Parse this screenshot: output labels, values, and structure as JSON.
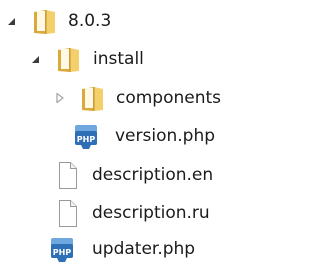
{
  "tree": {
    "root": {
      "label": "8.0.3",
      "expanded": true,
      "icon": "folder-icon"
    },
    "install": {
      "label": "install",
      "expanded": true,
      "icon": "folder-icon"
    },
    "components": {
      "label": "components",
      "expanded": false,
      "icon": "folder-icon"
    },
    "version_php": {
      "label": "version.php",
      "icon": "php-file-icon",
      "icon_text": "PHP"
    },
    "description_en": {
      "label": "description.en",
      "icon": "blank-file-icon"
    },
    "description_ru": {
      "label": "description.ru",
      "icon": "blank-file-icon"
    },
    "updater_php": {
      "label": "updater.php",
      "icon": "php-file-icon",
      "icon_text": "PHP"
    }
  },
  "colors": {
    "folder_back": "#d9a93a",
    "folder_front": "#f4cf6b",
    "folder_page": "#fff8e6",
    "php_blue": "#2f6fb5",
    "php_light": "#6fa7df",
    "expander_solid": "#3b3b3b",
    "expander_outline": "#a8a8a8",
    "file_border": "#9a9a9a",
    "label_text": "#1b1b1b"
  }
}
